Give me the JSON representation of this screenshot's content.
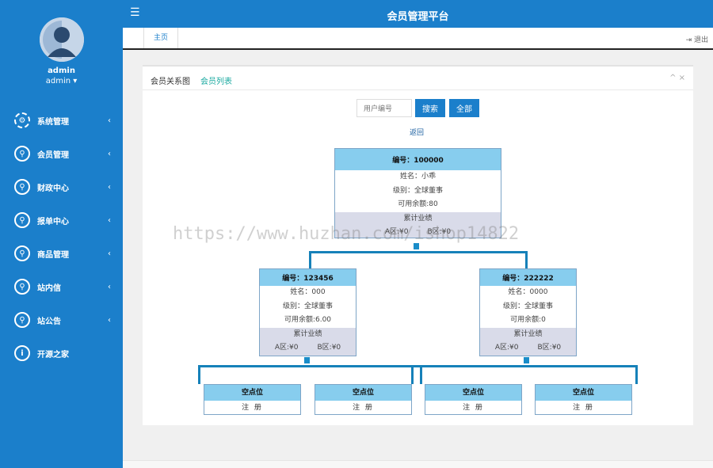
{
  "app": {
    "title": "会员管理平台"
  },
  "user": {
    "name": "admin",
    "role": "admin ▾"
  },
  "sidebar": {
    "items": [
      {
        "label": "系统管理",
        "icon": "gear-icon"
      },
      {
        "label": "会员管理",
        "icon": "user-icon"
      },
      {
        "label": "财政中心",
        "icon": "user-icon"
      },
      {
        "label": "报单中心",
        "icon": "user-icon"
      },
      {
        "label": "商品管理",
        "icon": "user-icon"
      },
      {
        "label": "站内信",
        "icon": "user-icon"
      },
      {
        "label": "站公告",
        "icon": "user-icon"
      },
      {
        "label": "开源之家",
        "icon": "info-icon"
      }
    ]
  },
  "tabs": {
    "home": "主页",
    "logout": "退出"
  },
  "panel": {
    "tab_relation": "会员关系图",
    "tab_list": "会员列表",
    "tools": "^ ×"
  },
  "search": {
    "placeholder": "用户编号",
    "search_btn": "搜索",
    "all_btn": "全部",
    "back": "返回"
  },
  "tree": {
    "root": {
      "id": "编号：100000",
      "name": "姓名：小乖",
      "level": "级别：全球董事",
      "balance": "可用余额:80",
      "perf": "累计业绩",
      "a": "A区:¥0",
      "b": "B区:¥0"
    },
    "left": {
      "id": "编号：123456",
      "name": "姓名：000",
      "level": "级别：全球董事",
      "balance": "可用余额:6.00",
      "perf": "累计业绩",
      "a": "A区:¥0",
      "b": "B区:¥0"
    },
    "right": {
      "id": "编号：222222",
      "name": "姓名：0000",
      "level": "级别：全球董事",
      "balance": "可用余额:0",
      "perf": "累计业绩",
      "a": "A区:¥0",
      "b": "B区:¥0"
    },
    "empty": [
      {
        "title": "空点位",
        "action": "注 册"
      },
      {
        "title": "空点位",
        "action": "注 册"
      },
      {
        "title": "空点位",
        "action": "注 册"
      },
      {
        "title": "空点位",
        "action": "注 册"
      }
    ]
  },
  "watermark": "https://www.huzhan.com/ishop14822",
  "colors": {
    "primary": "#1b7fcb",
    "node_head": "#87cdee",
    "node_foot": "#d9dbe9",
    "teal": "#1aa9a0"
  }
}
